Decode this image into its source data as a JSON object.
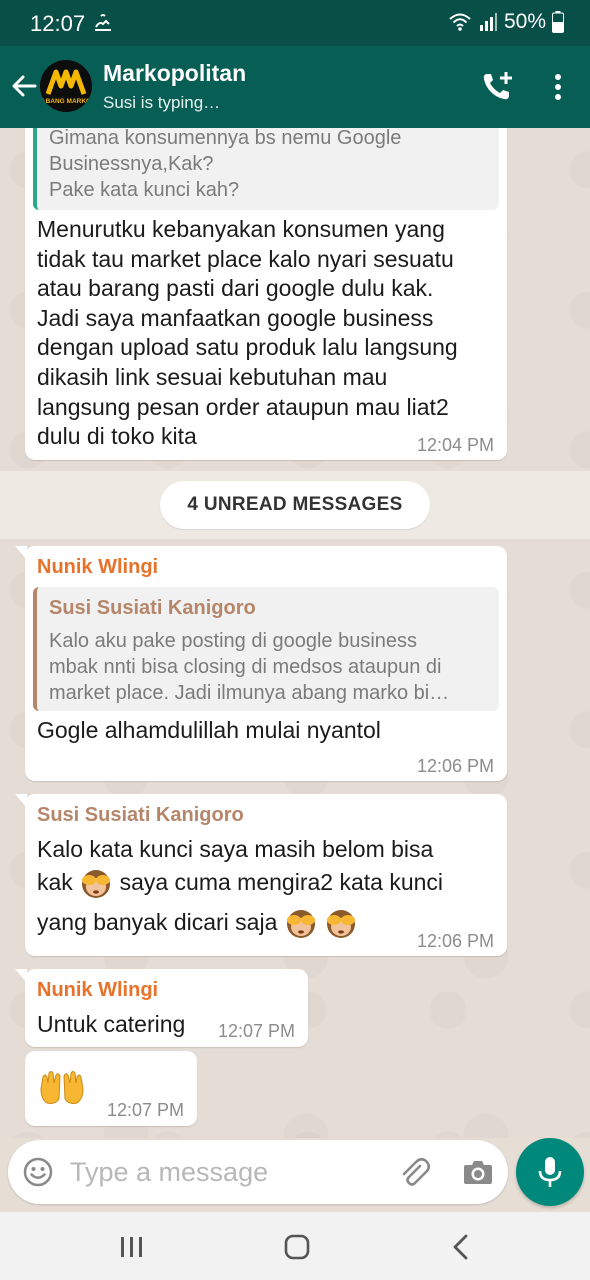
{
  "status_bar": {
    "time": "12:07",
    "battery": "50%"
  },
  "header": {
    "title": "Markopolitan",
    "subtitle": "Susi is typing…",
    "avatar_text_top": "AM",
    "avatar_text_bottom": "ABANG MARKO"
  },
  "messages": {
    "m1": {
      "quote_lines": [
        "Gimana konsumennya bs nemu Google",
        "Businessnya,Kak?",
        "Pake kata kunci kah?"
      ],
      "text_lines": [
        "Menurutku kebanyakan konsumen yang",
        "tidak tau market place kalo nyari sesuatu",
        "atau barang pasti dari google dulu kak.",
        "Jadi saya manfaatkan google business",
        "dengan upload satu produk lalu langsung",
        "dikasih link sesuai kebutuhan mau",
        "langsung pesan order ataupun mau liat2",
        "dulu di toko kita"
      ],
      "time": "12:04 PM"
    },
    "unread_label": "4 UNREAD MESSAGES",
    "m2": {
      "sender": "Nunik Wlingi",
      "quote_sender": "Susi Susiati Kanigoro",
      "quote_lines": [
        "Kalo aku pake posting di google business",
        "mbak nnti bisa closing di medsos ataupun di",
        "market place. Jadi ilmunya abang marko bi…"
      ],
      "text": "Gogle alhamdulillah mulai nyantol",
      "time": "12:06 PM"
    },
    "m3": {
      "sender": "Susi Susiati Kanigoro",
      "line1": "Kalo kata kunci saya masih belom bisa",
      "line2_a": "kak",
      "line2_b": "saya cuma mengira2 kata kunci",
      "line3": "yang banyak dicari saja",
      "time": "12:06 PM"
    },
    "m4": {
      "sender": "Nunik Wlingi",
      "text": "Untuk catering",
      "time": "12:07 PM"
    },
    "m5": {
      "time": "12:07 PM"
    }
  },
  "composer": {
    "placeholder": "Type a message"
  },
  "colors": {
    "header_bg": "#075e54",
    "sender_nunik": "#e8722a",
    "sender_susi": "#b5866a",
    "quote_bar_green": "#29a88e",
    "mic_bg": "#00897b"
  },
  "icons": [
    "back-arrow-icon",
    "add-call-icon",
    "more-vert-icon",
    "emoji-icon",
    "attach-icon",
    "camera-icon",
    "mic-icon",
    "see-no-evil-monkey-emoji",
    "raised-hands-emoji"
  ]
}
